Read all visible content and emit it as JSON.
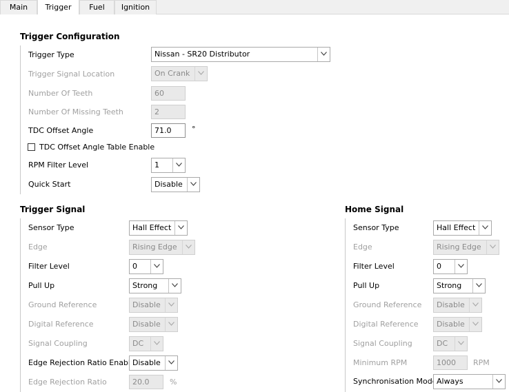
{
  "tabs": [
    {
      "label": "Main"
    },
    {
      "label": "Trigger"
    },
    {
      "label": "Fuel"
    },
    {
      "label": "Ignition"
    }
  ],
  "trigger_config": {
    "title": "Trigger Configuration",
    "trigger_type": {
      "label": "Trigger Type",
      "value": "Nissan - SR20 Distributor"
    },
    "signal_location": {
      "label": "Trigger Signal Location",
      "value": "On Crank"
    },
    "num_teeth": {
      "label": "Number Of Teeth",
      "value": "60"
    },
    "missing_teeth": {
      "label": "Number Of Missing Teeth",
      "value": "2"
    },
    "tdc_offset": {
      "label": "TDC Offset Angle",
      "value": "71.0",
      "unit": "°"
    },
    "tdc_table_enable": {
      "label": "TDC Offset Angle Table Enable",
      "checked": false
    },
    "rpm_filter": {
      "label": "RPM Filter Level",
      "value": "1"
    },
    "quick_start": {
      "label": "Quick Start",
      "value": "Disable"
    }
  },
  "trigger_signal": {
    "title": "Trigger Signal",
    "sensor_type": {
      "label": "Sensor Type",
      "value": "Hall Effect"
    },
    "edge": {
      "label": "Edge",
      "value": "Rising Edge"
    },
    "filter_level": {
      "label": "Filter Level",
      "value": "0"
    },
    "pull_up": {
      "label": "Pull Up",
      "value": "Strong"
    },
    "ground_ref": {
      "label": "Ground Reference",
      "value": "Disable"
    },
    "digital_ref": {
      "label": "Digital Reference",
      "value": "Disable"
    },
    "coupling": {
      "label": "Signal Coupling",
      "value": "DC"
    },
    "edge_rej_enable": {
      "label": "Edge Rejection Ratio Enable",
      "value": "Disable"
    },
    "edge_rej_ratio": {
      "label": "Edge Rejection Ratio",
      "value": "20.0",
      "unit": "%"
    }
  },
  "home_signal": {
    "title": "Home Signal",
    "sensor_type": {
      "label": "Sensor Type",
      "value": "Hall Effect"
    },
    "edge": {
      "label": "Edge",
      "value": "Rising Edge"
    },
    "filter_level": {
      "label": "Filter Level",
      "value": "0"
    },
    "pull_up": {
      "label": "Pull Up",
      "value": "Strong"
    },
    "ground_ref": {
      "label": "Ground Reference",
      "value": "Disable"
    },
    "digital_ref": {
      "label": "Digital Reference",
      "value": "Disable"
    },
    "coupling": {
      "label": "Signal Coupling",
      "value": "DC"
    },
    "min_rpm": {
      "label": "Minimum RPM",
      "value": "1000",
      "unit": "RPM"
    },
    "sync_mode": {
      "label": "Synchronisation Mode",
      "value": "Always"
    }
  }
}
